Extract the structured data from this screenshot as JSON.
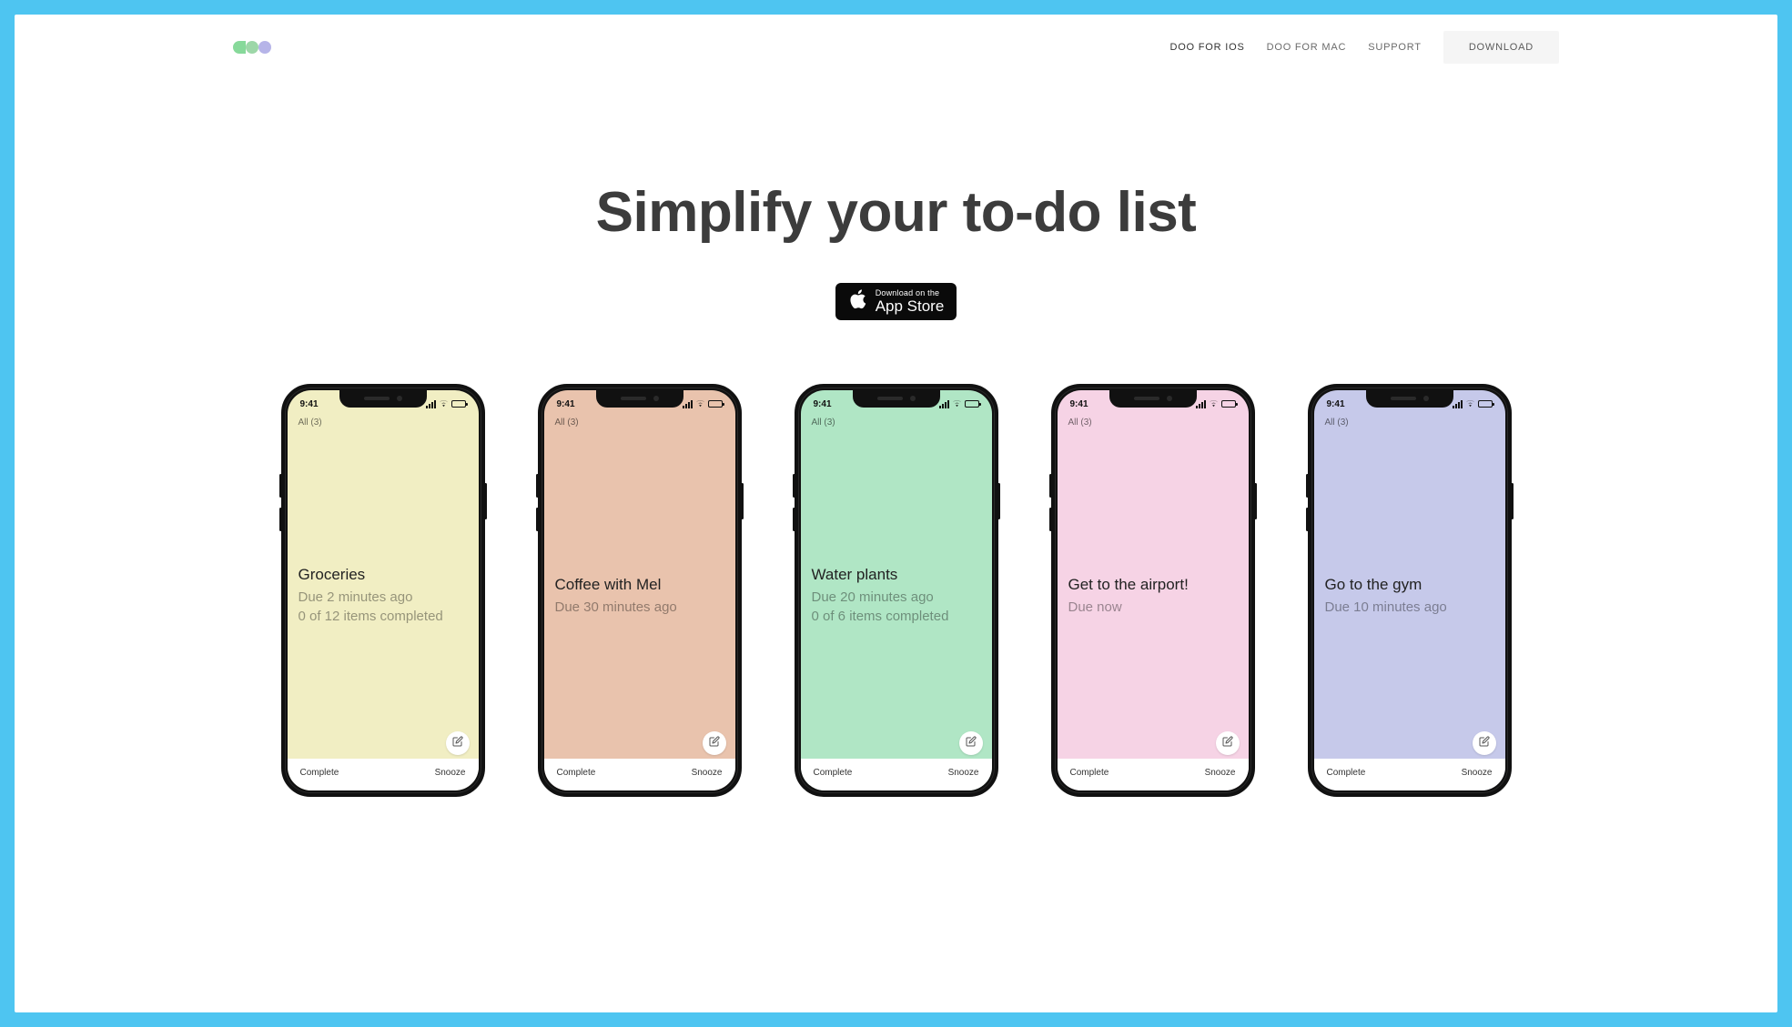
{
  "nav": {
    "links": [
      {
        "label": "DOO FOR IOS",
        "active": true
      },
      {
        "label": "DOO FOR MAC",
        "active": false
      },
      {
        "label": "SUPPORT",
        "active": false
      }
    ],
    "download_label": "DOWNLOAD"
  },
  "hero": {
    "title": "Simplify your to-do list",
    "app_store_small": "Download on the",
    "app_store_big": "App Store"
  },
  "phone_ui": {
    "time": "9:41",
    "list_label": "All (3)",
    "complete_label": "Complete",
    "snooze_label": "Snooze"
  },
  "phones": [
    {
      "color_class": "c0",
      "title": "Groceries",
      "sub1": "Due 2 minutes ago",
      "sub2": "0 of 12 items completed"
    },
    {
      "color_class": "c1",
      "title": "Coffee with Mel",
      "sub1": "Due 30 minutes ago",
      "sub2": ""
    },
    {
      "color_class": "c2",
      "title": "Water plants",
      "sub1": "Due 20 minutes ago",
      "sub2": "0 of 6 items completed"
    },
    {
      "color_class": "c3",
      "title": "Get to the airport!",
      "sub1": "Due now",
      "sub2": ""
    },
    {
      "color_class": "c4",
      "title": "Go to the gym",
      "sub1": "Due 10 minutes ago",
      "sub2": ""
    }
  ]
}
